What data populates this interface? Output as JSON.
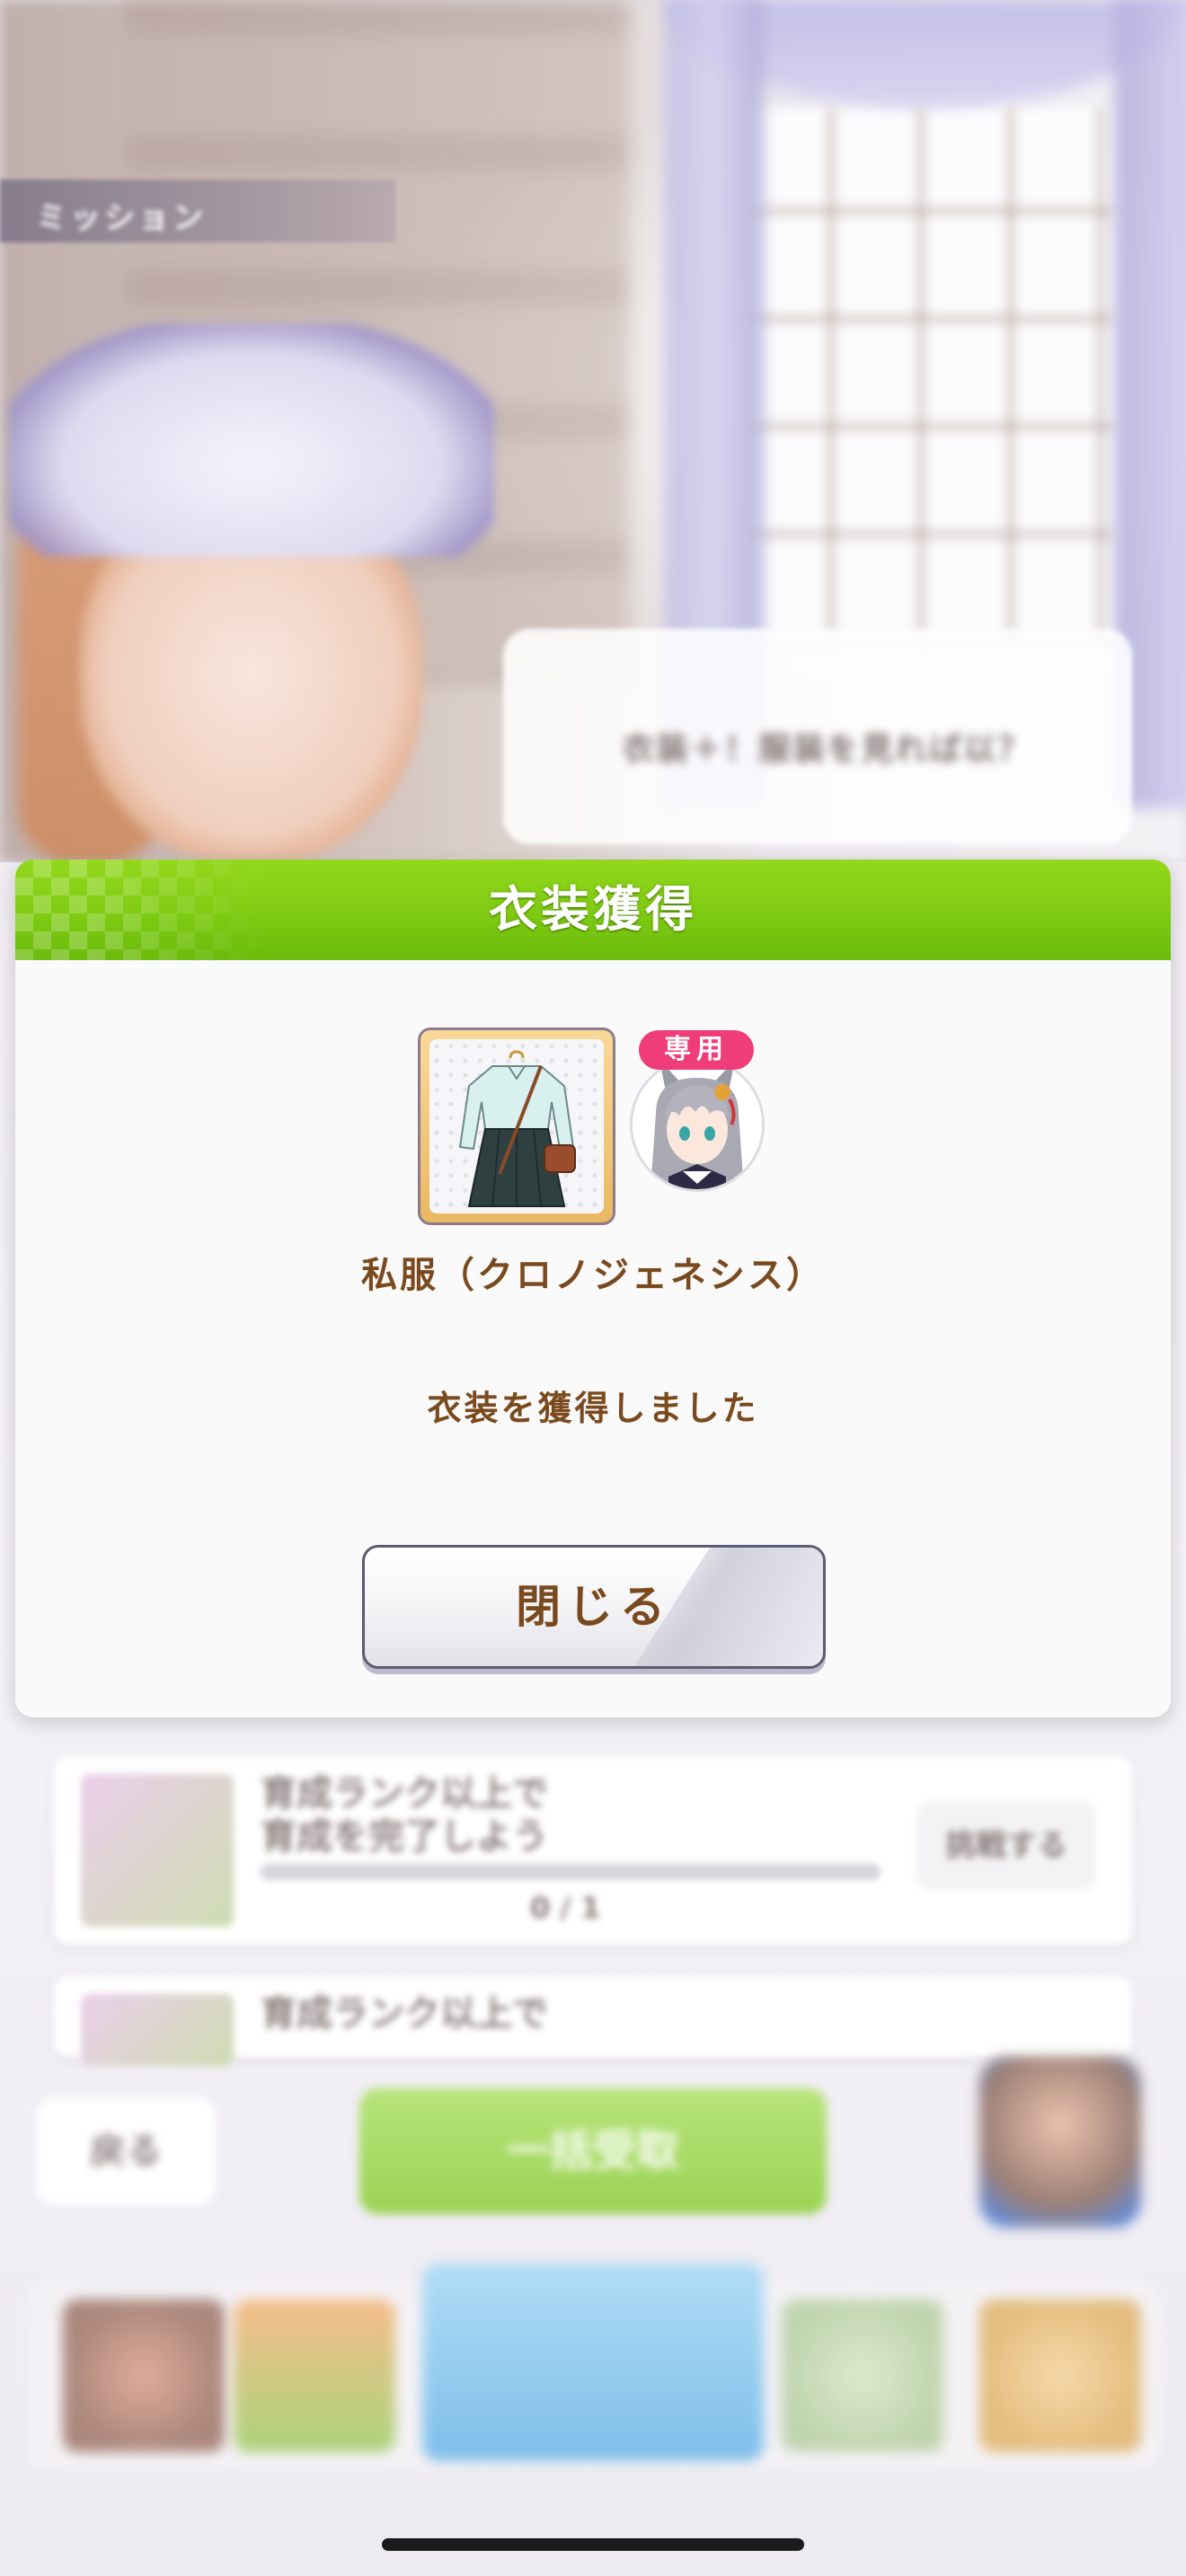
{
  "background": {
    "scene_label": "ミッション",
    "speech_text": "衣装＋！服装を見れば以？",
    "missions": [
      {
        "text_line1": "育成ランク以上で",
        "text_line2": "育成を完了しよう",
        "progress": "0 / 1",
        "button": "挑戦する"
      },
      {
        "text_line1": "育成ランク以上で",
        "text_line2": "",
        "progress": "",
        "button": ""
      }
    ],
    "back_label": "戻る",
    "bulk_label": "一括受取"
  },
  "dialog": {
    "title": "衣装獲得",
    "badge": "専用",
    "item_name": "私服（クロノジェネシス）",
    "message": "衣装を獲得しました",
    "close_label": "閉じる"
  },
  "colors": {
    "header_green": "#7fcb13",
    "text_brown": "#7a4a1e",
    "badge_pink": "#ef3d7a",
    "button_border": "#5d5a73"
  }
}
